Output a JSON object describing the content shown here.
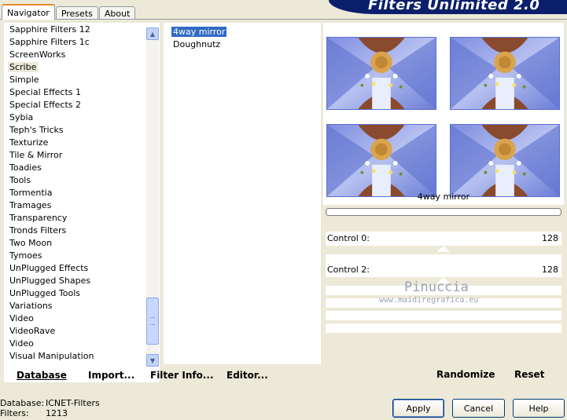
{
  "tabs": [
    {
      "label": "Navigator",
      "active": true
    },
    {
      "label": "Presets",
      "active": false
    },
    {
      "label": "About",
      "active": false
    }
  ],
  "banner": {
    "title": "Filters Unlimited 2.0"
  },
  "categories": [
    "Sapphire Filters 12",
    "Sapphire Filters 1c",
    "ScreenWorks",
    "Scribe",
    "Simple",
    "Special Effects 1",
    "Special Effects 2",
    "Sybia",
    "Teph's Tricks",
    "Texturize",
    "Tile & Mirror",
    "Toadies",
    "Tools",
    "Tormentia",
    "Tramages",
    "Transparency",
    "Tronds Filters",
    "Two Moon",
    "Tymoes",
    "UnPlugged Effects",
    "UnPlugged Shapes",
    "UnPlugged Tools",
    "Variations",
    "Video",
    "VideoRave",
    "Video",
    "Visual Manipulation"
  ],
  "selected_category": "Scribe",
  "filters": [
    "4way mirror",
    "Doughnutz"
  ],
  "selected_filter": "4way mirror",
  "left_toolbar": {
    "database": "Database",
    "import": "Import...",
    "filter_info": "Filter Info...",
    "editor": "Editor..."
  },
  "preview": {
    "filter_name": "4way mirror"
  },
  "controls": [
    {
      "label": "Control 0:",
      "value": "128"
    },
    {
      "label": "Control 2:",
      "value": "128"
    }
  ],
  "right_toolbar": {
    "randomize": "Randomize",
    "reset": "Reset"
  },
  "watermark": {
    "name": "Pinuccia",
    "url": "www.maidiregrafica.eu"
  },
  "status": {
    "database_label": "Database:",
    "database_value": "ICNET-Filters",
    "filters_label": "Filters:",
    "filters_value": "1213"
  },
  "buttons": {
    "apply": "Apply",
    "cancel": "Cancel",
    "help": "Help"
  },
  "colors": {
    "selection": "#316ac5",
    "banner": "#0a1f6b",
    "tab_accent": "#e68b2c"
  }
}
